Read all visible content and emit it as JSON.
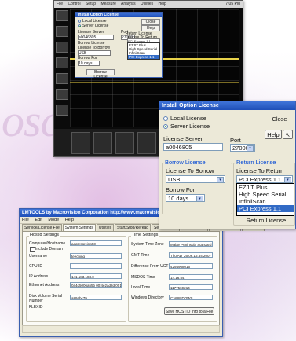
{
  "background": {
    "watermark_text": "oscc"
  },
  "scope": {
    "menu": [
      "File",
      "Control",
      "Setup",
      "Measure",
      "Analysis",
      "Utilities",
      "Help"
    ],
    "clock": "7:05 PM",
    "mini_dialog": {
      "title": "Install Option License",
      "local_license": "Local License",
      "server_license": "Server License",
      "close": "Close",
      "help": "Help",
      "license_server_label": "License Server",
      "license_server_value": "a0046805",
      "port_label": "Port",
      "port_value": "27000",
      "borrow_group": "Borrow License",
      "borrow_to_label": "License To Borrow",
      "borrow_to_value": "USB",
      "borrow_for_label": "Borrow For",
      "borrow_for_value": "10 days",
      "borrow_button": "Borrow License",
      "return_group": "Return License",
      "return_to_label": "License To Return",
      "return_to_value": "PCI Express 1.1",
      "options": [
        "EZJIT Plus",
        "High Speed Serial",
        "InfiniiScan",
        "PCI Express 1.1"
      ]
    }
  },
  "install_license": {
    "title": "Install Option License",
    "local_license": "Local License",
    "server_license": "Server License",
    "close": "Close",
    "help": "Help",
    "license_server_label": "License Server",
    "license_server_value": "a0046805",
    "port_label": "Port",
    "port_value": "27000",
    "borrow_group": "Borrow License",
    "borrow_to_label": "License To Borrow",
    "borrow_to_value": "USB",
    "borrow_for_label": "Borrow For",
    "borrow_for_value": "10 days",
    "return_group": "Return License",
    "return_to_label": "License To Return",
    "return_to_value": "PCI Express 1.1",
    "options": [
      "EZJIT Plus",
      "High Speed Serial",
      "InfiniiScan",
      "PCI Express 1.1"
    ],
    "return_button": "Return License"
  },
  "lmtools": {
    "title": "LMTOOLS by Macrovision Corporation http://www.macrovision.com",
    "menu": [
      "File",
      "Edit",
      "Mode",
      "Help"
    ],
    "tabs": [
      "Service/License File",
      "System Settings",
      "Utilities",
      "Start/Stop/Reread",
      "Server Status",
      "Server Diags",
      "Config Services",
      "Borrowing"
    ],
    "hostid_group": "Hostid Settings",
    "hostid_fields": [
      {
        "label": "Computer/Hostname",
        "value": "agatesgrcing93"
      },
      {
        "label": "Username",
        "value": "teeching"
      },
      {
        "label": "CPU ID",
        "value": ""
      },
      {
        "label": "IP Address",
        "value": "141.183.183.0"
      },
      {
        "label": "Ethernet Address",
        "value": "0a4d5006a55b 00f4e2ad8d 001f88d9"
      },
      {
        "label": "Disk Volume Serial Number",
        "value": "a89abc79"
      },
      {
        "label": "FLEXID",
        "value": ""
      }
    ],
    "include_domain": "Include Domain",
    "time_group": "Time Settings",
    "time_fields": [
      {
        "label": "System Time Zone",
        "value": "Malay Peninsula Standard Time"
      },
      {
        "label": "GMT Time",
        "value": "Thu Apr 26 06:16:54 2007"
      },
      {
        "label": "Difference From UCT",
        "value": "4294968016"
      },
      {
        "label": "MSDOS Time",
        "value": "14:16:54"
      },
      {
        "label": "Local Time",
        "value": "1177569214"
      },
      {
        "label": "Windows Directory",
        "value": "C:\\WINDOWS"
      }
    ],
    "save_button": "Save HOSTID Info to a File"
  }
}
